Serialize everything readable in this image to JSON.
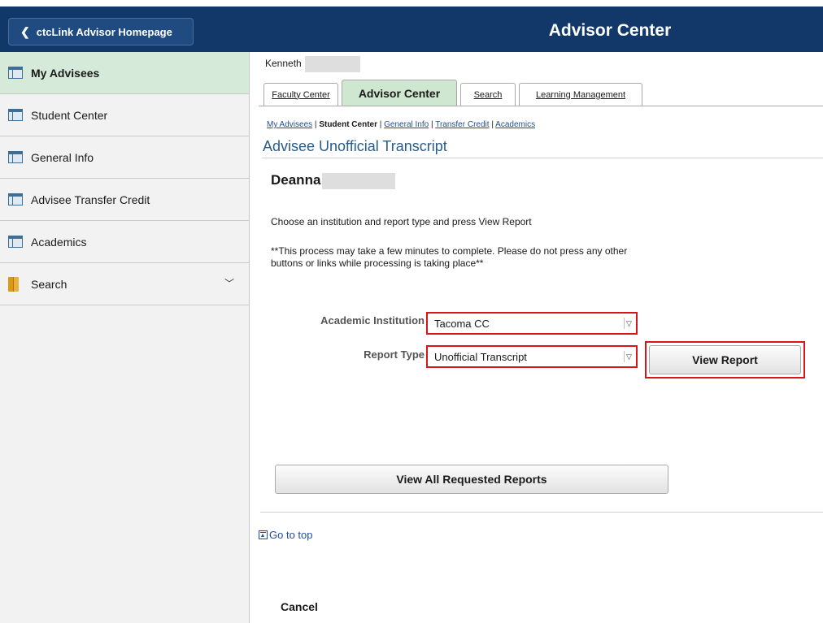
{
  "header": {
    "home_label": "ctcLink Advisor Homepage",
    "title": "Advisor Center"
  },
  "sidebar": {
    "items": [
      {
        "label": "My Advisees",
        "icon": "page-icon",
        "active": true
      },
      {
        "label": "Student Center",
        "icon": "page-icon"
      },
      {
        "label": "General Info",
        "icon": "page-icon"
      },
      {
        "label": "Advisee Transfer Credit",
        "icon": "page-icon"
      },
      {
        "label": "Academics",
        "icon": "page-icon"
      },
      {
        "label": "Search",
        "icon": "folder-icon",
        "expandable": true
      }
    ]
  },
  "main": {
    "user_name": "Kenneth",
    "tabs": [
      {
        "label": "Faculty Center"
      },
      {
        "label": "Advisor Center",
        "active": true
      },
      {
        "label": "Search"
      },
      {
        "label": "Learning Management"
      }
    ],
    "breadcrumbs": {
      "my_advisees": "My Advisees",
      "student_center": "Student Center",
      "general_info": "General Info",
      "transfer_credit": "Transfer Credit",
      "academics": "Academics",
      "separator": "|"
    },
    "page_title": "Advisee Unofficial Transcript",
    "student_name": "Deanna",
    "instructions": "Choose an institution and report type and press View Report",
    "note": "**This process may take a few minutes to complete. Please do not press any other buttons or links while processing is taking place**",
    "institution": {
      "label": "Academic Institution",
      "value": "Tacoma CC"
    },
    "report_type": {
      "label": "Report Type",
      "value": "Unofficial Transcript"
    },
    "view_report_label": "View Report",
    "view_all_label": "View All Requested Reports",
    "go_to_top": "Go to top",
    "cancel": "Cancel"
  },
  "colors": {
    "header_bg": "#12386a",
    "active_bg": "#d5ead8",
    "highlight": "#d8151b",
    "link": "#1f4e96"
  }
}
